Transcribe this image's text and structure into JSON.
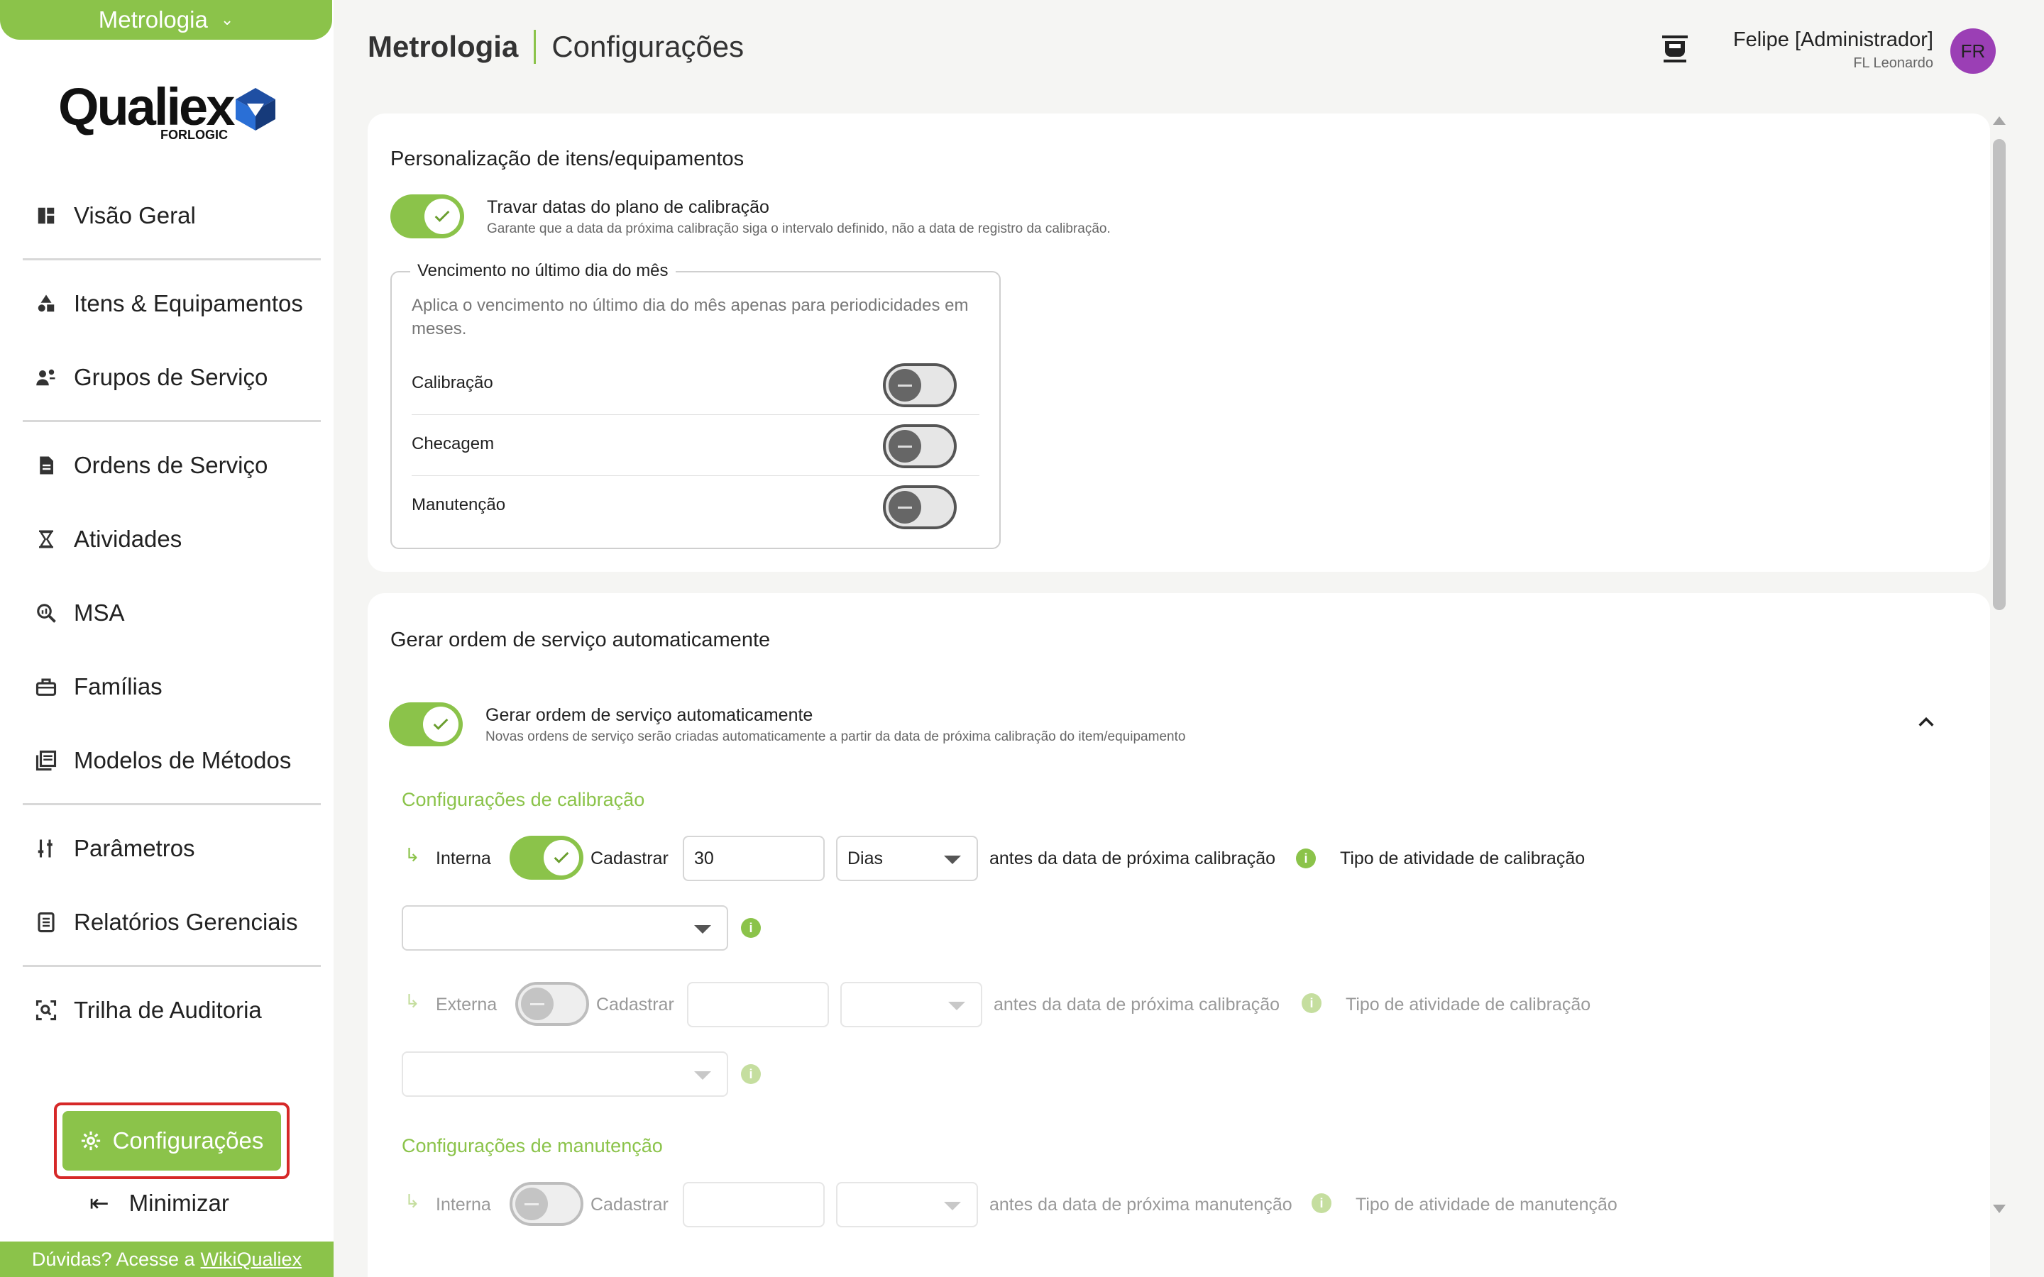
{
  "sidebar": {
    "module_label": "Metrologia",
    "logo_text": "Qualiex",
    "logo_sub": "FORLOGIC",
    "items": [
      {
        "label": "Visão Geral",
        "icon": "dashboard-icon"
      },
      {
        "label": "Itens & Equipamentos",
        "icon": "shapes-icon"
      },
      {
        "label": "Grupos de Serviço",
        "icon": "group-icon"
      },
      {
        "label": "Ordens de Serviço",
        "icon": "document-icon"
      },
      {
        "label": "Atividades",
        "icon": "hourglass-icon"
      },
      {
        "label": "MSA",
        "icon": "search-chart-icon"
      },
      {
        "label": "Famílias",
        "icon": "toolbox-icon"
      },
      {
        "label": "Modelos de Métodos",
        "icon": "library-icon"
      },
      {
        "label": "Parâmetros",
        "icon": "sliders-icon"
      },
      {
        "label": "Relatórios Gerenciais",
        "icon": "report-icon"
      },
      {
        "label": "Trilha de Auditoria",
        "icon": "audit-icon"
      }
    ],
    "config_label": "Configurações",
    "minimize_label": "Minimizar",
    "help_prefix": "Dúvidas? Acesse a",
    "help_link": "WikiQualiex"
  },
  "header": {
    "module": "Metrologia",
    "page": "Configurações",
    "user_name": "Felipe [Administrador]",
    "user_org": "FL Leonardo",
    "avatar_initials": "FR"
  },
  "card1": {
    "title": "Personalização de itens/equipamentos",
    "lock_dates": {
      "title": "Travar datas do plano de calibração",
      "desc": "Garante que a data da próxima calibração siga o intervalo definido, não a data de registro da calibração.",
      "enabled": true
    },
    "due_last_day": {
      "legend": "Vencimento no último dia do mês",
      "desc": "Aplica o vencimento no último dia do mês apenas para periodicidades em meses.",
      "rows": [
        {
          "label": "Calibração",
          "enabled": false
        },
        {
          "label": "Checagem",
          "enabled": false
        },
        {
          "label": "Manutenção",
          "enabled": false
        }
      ]
    }
  },
  "card2": {
    "title": "Gerar ordem de serviço automaticamente",
    "auto_generate": {
      "title": "Gerar ordem de serviço automaticamente",
      "desc": "Novas ordens de serviço serão criadas automaticamente a partir da data de próxima calibração do item/equipamento",
      "enabled": true
    },
    "calibration": {
      "section_title": "Configurações de calibração",
      "internal": {
        "label": "Interna",
        "register_label": "Cadastrar",
        "days_value": "30",
        "unit_value": "Dias",
        "before_label": "antes da data de próxima calibração",
        "type_label": "Tipo de atividade de calibração",
        "enabled": true
      },
      "external": {
        "label": "Externa",
        "register_label": "Cadastrar",
        "before_label": "antes da data de próxima calibração",
        "type_label": "Tipo de atividade de calibração",
        "enabled": false
      }
    },
    "maintenance": {
      "section_title": "Configurações de manutenção",
      "internal": {
        "label": "Interna",
        "register_label": "Cadastrar",
        "before_label": "antes da data de próxima manutenção",
        "type_label": "Tipo de atividade de manutenção",
        "enabled": false
      }
    }
  },
  "colors": {
    "accent": "#8bc34a",
    "highlight_outline": "#d62828",
    "avatar": "#9b3fb5"
  }
}
